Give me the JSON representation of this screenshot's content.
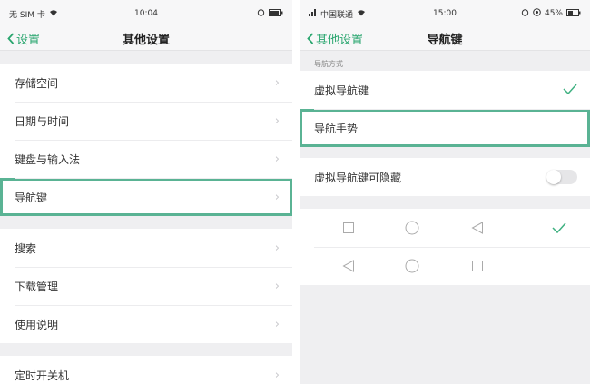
{
  "left": {
    "status": {
      "carrier": "无 SIM 卡",
      "time": "10:04"
    },
    "nav": {
      "back": "设置",
      "title": "其他设置"
    },
    "groups": [
      [
        "存储空间",
        "日期与时间",
        "键盘与输入法",
        "导航键"
      ],
      [
        "搜索",
        "下载管理",
        "使用说明"
      ],
      [
        "定时开关机"
      ]
    ]
  },
  "right": {
    "status": {
      "carrier": "中国联通",
      "time": "15:00",
      "battery": "45%"
    },
    "nav": {
      "back": "其他设置",
      "title": "导航键"
    },
    "section_label": "导航方式",
    "options": [
      "虚拟导航键",
      "导航手势"
    ],
    "hide_option": "虚拟导航键可隐藏",
    "hide_enabled": false,
    "accent": "#3fb181",
    "highlight_color": "#5ab394"
  }
}
